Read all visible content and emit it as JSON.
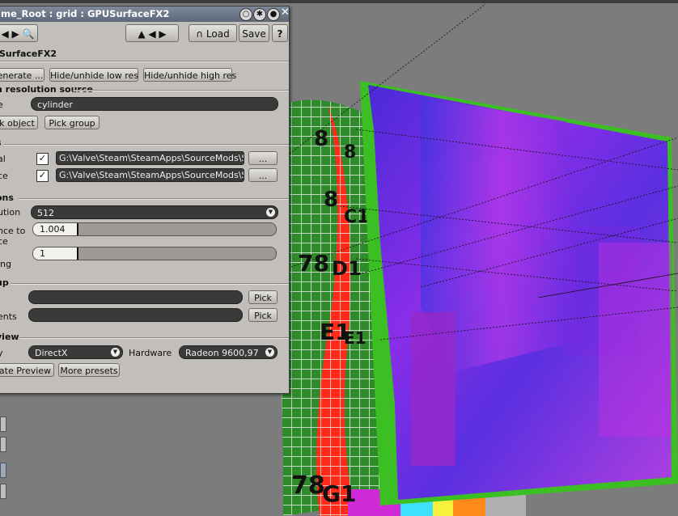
{
  "window": {
    "title": "me_Root : grid : GPUSurfaceFX2",
    "subtitle": "SurfaceFX2"
  },
  "toolbar": {
    "load_label": "Load",
    "save_label": "Save",
    "help_label": "?"
  },
  "buttons": {
    "generate": "enerate ...",
    "hide_low": "Hide/unhide low res",
    "hide_high": "Hide/unhide high res"
  },
  "source": {
    "section": "n resolution source",
    "field_label": "e",
    "value": "cylinder",
    "pick_object": "k object",
    "pick_group": "Pick group"
  },
  "maps": {
    "section": "s",
    "rows": [
      {
        "label": "al",
        "checked": true,
        "path": "G:\\Valve\\Steam\\SteamApps\\SourceMods\\S",
        "browse": "..."
      },
      {
        "label": "ce",
        "checked": true,
        "path": "G:\\Valve\\Steam\\SteamApps\\SourceMods\\S",
        "browse": "..."
      }
    ]
  },
  "options": {
    "section": "ons",
    "resolution_label": "ution",
    "resolution": "512",
    "distance_label": "nce to",
    "distance_label2": "ce",
    "distance_value": "1.004",
    "distance_fill": 0.18,
    "sampling_label": "ing",
    "sampling_value": "1",
    "sampling_fill": 0.18
  },
  "cage": {
    "section": "up",
    "pick1": "Pick",
    "pick2": "Pick",
    "label2": "ents"
  },
  "preview": {
    "section": "view",
    "api_label": "y",
    "api": "DirectX",
    "hardware_label": "Hardware",
    "hardware": "Radeon 9600,97",
    "update": "ate Preview",
    "more": "More presets"
  },
  "scene": {
    "grid_labels": [
      "8",
      "8",
      "8",
      "C1",
      "78",
      "D1",
      "E1",
      "E1",
      "78",
      "G1"
    ]
  },
  "colors": {
    "viewport": "#7c7c7c",
    "panel": "#c2bfba",
    "titlebar": "#5c6878",
    "plane_green": "#3cbf23"
  }
}
